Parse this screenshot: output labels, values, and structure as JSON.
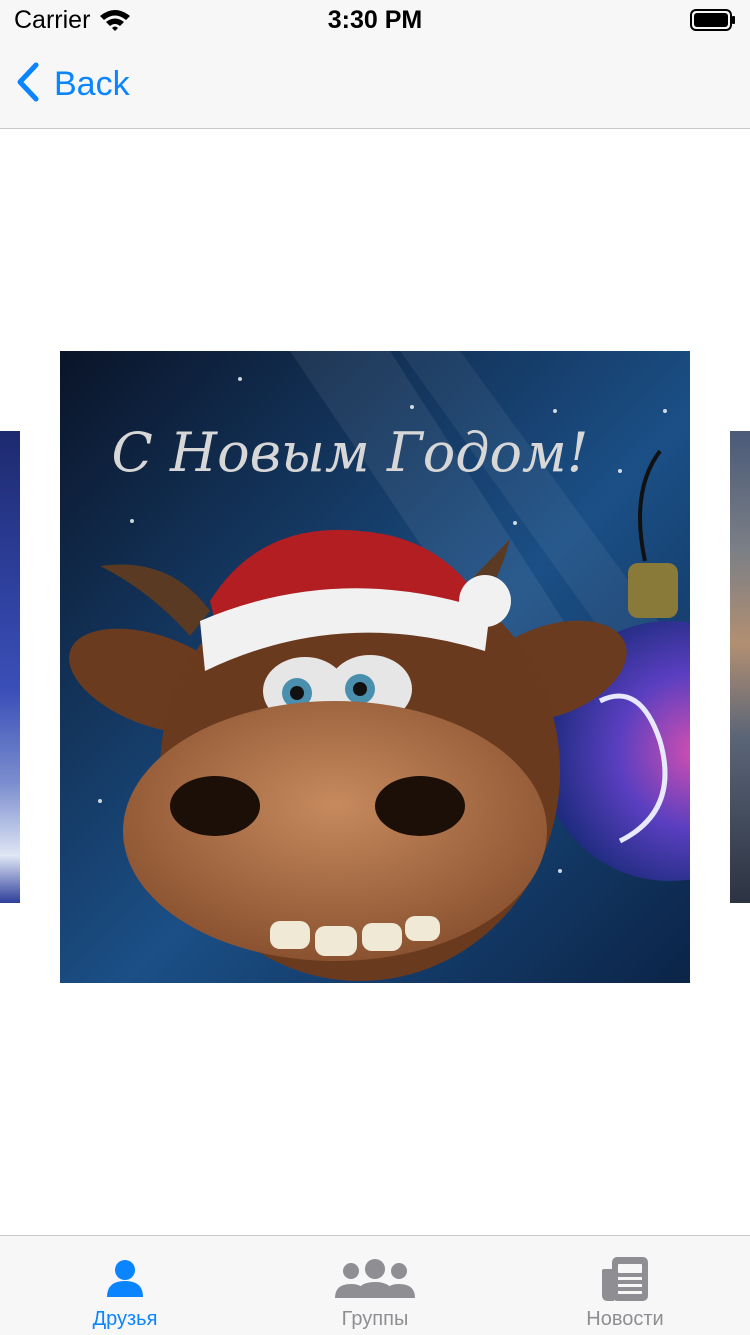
{
  "status_bar": {
    "carrier": "Carrier",
    "time": "3:30 PM"
  },
  "nav_bar": {
    "back_label": "Back"
  },
  "photo": {
    "greeting": "С Новым Годом!"
  },
  "tabs": [
    {
      "label": "Друзья",
      "icon": "person-icon",
      "active": true
    },
    {
      "label": "Группы",
      "icon": "people-group-icon",
      "active": false
    },
    {
      "label": "Новости",
      "icon": "newspaper-icon",
      "active": false
    }
  ],
  "colors": {
    "accent": "#0a84ff",
    "inactive": "#8e8e93",
    "bar_background": "#f7f7f7"
  }
}
